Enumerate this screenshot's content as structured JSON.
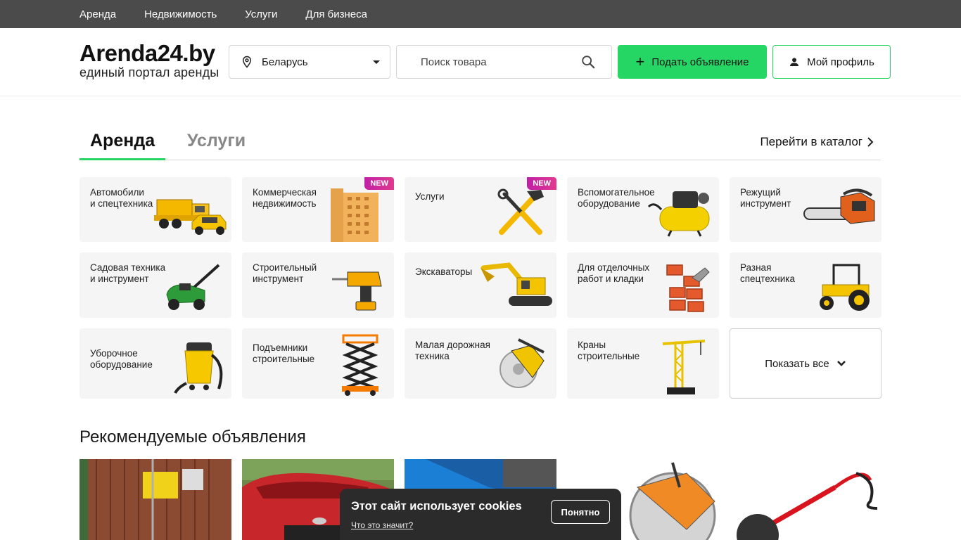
{
  "topnav": [
    "Аренда",
    "Недвижимость",
    "Услуги",
    "Для бизнеса"
  ],
  "logo": {
    "title": "Arenda24.by",
    "subtitle": "единый портал аренды"
  },
  "region": {
    "value": "Беларусь"
  },
  "search": {
    "placeholder": "Поиск товара"
  },
  "buttons": {
    "post": "Подать объявление",
    "profile": "Мой профиль"
  },
  "tabs": {
    "active": "Аренда",
    "inactive": "Услуги",
    "catalog": "Перейти в каталог"
  },
  "categories": [
    {
      "label": "Автомобили\nи спецтехника",
      "icon": "dump-truck-icon"
    },
    {
      "label": "Коммерческая\nнедвижимость",
      "icon": "building-icon",
      "badge": "NEW"
    },
    {
      "label": "Услуги",
      "icon": "hammer-wrench-icon",
      "badge": "NEW"
    },
    {
      "label": "Вспомогательное\nоборудование",
      "icon": "compressor-icon"
    },
    {
      "label": "Режущий\nинструмент",
      "icon": "chainsaw-icon"
    },
    {
      "label": "Садовая техника\nи инструмент",
      "icon": "lawn-mower-icon"
    },
    {
      "label": "Строительный\nинструмент",
      "icon": "drill-icon"
    },
    {
      "label": "Экскаваторы",
      "icon": "excavator-icon"
    },
    {
      "label": "Для отделочных\nработ и кладки",
      "icon": "bricks-icon"
    },
    {
      "label": "Разная\nспецтехника",
      "icon": "tractor-icon"
    },
    {
      "label": "Уборочное\nоборудование",
      "icon": "vacuum-cleaner-icon"
    },
    {
      "label": "Подъемники\nстроительные",
      "icon": "scissor-lift-icon"
    },
    {
      "label": "Малая дорожная\nтехника",
      "icon": "road-saw-icon"
    },
    {
      "label": "Краны\nстроительные",
      "icon": "tower-crane-icon"
    }
  ],
  "show_all": "Показать все",
  "recommended_title": "Рекомендуемые объявления",
  "cookie": {
    "title": "Этот сайт использует cookies",
    "link": "Что это значит?",
    "button": "Понятно"
  }
}
